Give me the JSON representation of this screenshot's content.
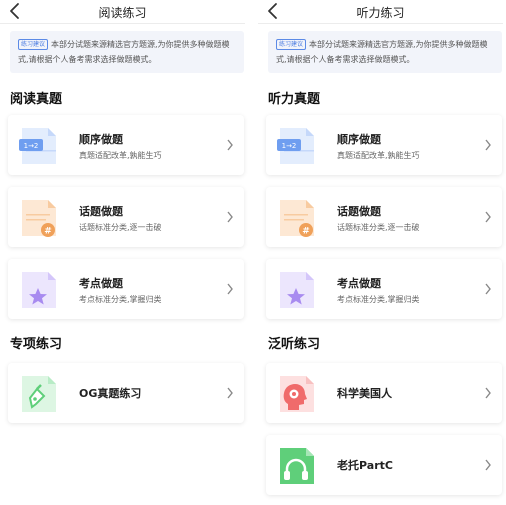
{
  "left": {
    "nav_title": "阅读练习",
    "notice_tag": "练习建议",
    "notice_text": "本部分试题来源精选官方题源,为你提供多种做题模式,请根据个人备考需求选择做题模式。",
    "section1_title": "阅读真题",
    "section2_title": "专项练习",
    "cards": [
      {
        "title": "顺序做题",
        "subtitle": "真题适配改革,孰能生巧",
        "icon": "sequence-doc-icon",
        "icon_text": "1→2"
      },
      {
        "title": "话题做题",
        "subtitle": "话题标准分类,逐一击破",
        "icon": "topic-doc-icon",
        "icon_text": "#"
      },
      {
        "title": "考点做题",
        "subtitle": "考点标准分类,掌握归类",
        "icon": "star-doc-icon"
      },
      {
        "title": "OG真题练习",
        "subtitle": "",
        "icon": "pen-doc-icon"
      }
    ]
  },
  "right": {
    "nav_title": "听力练习",
    "notice_tag": "练习建议",
    "notice_text": "本部分试题来源精选官方题源,为你提供多种做题模式,请根据个人备考需求选择做题模式。",
    "section1_title": "听力真题",
    "section2_title": "泛听练习",
    "cards": [
      {
        "title": "顺序做题",
        "subtitle": "真题适配改革,孰能生巧",
        "icon": "sequence-doc-icon",
        "icon_text": "1→2"
      },
      {
        "title": "话题做题",
        "subtitle": "话题标准分类,逐一击破",
        "icon": "topic-doc-icon",
        "icon_text": "#"
      },
      {
        "title": "考点做题",
        "subtitle": "考点标准分类,掌握归类",
        "icon": "star-doc-icon"
      },
      {
        "title": "科学美国人",
        "subtitle": "",
        "icon": "head-doc-icon"
      },
      {
        "title": "老托PartC",
        "subtitle": "",
        "icon": "headphones-doc-icon"
      }
    ]
  },
  "colors": {
    "blue": "#6f9ef0",
    "orange": "#f0a15a",
    "purple": "#a88bf0",
    "green": "#5fcf7a",
    "red": "#f06b6b",
    "notice_bg": "#f2f4fa"
  }
}
